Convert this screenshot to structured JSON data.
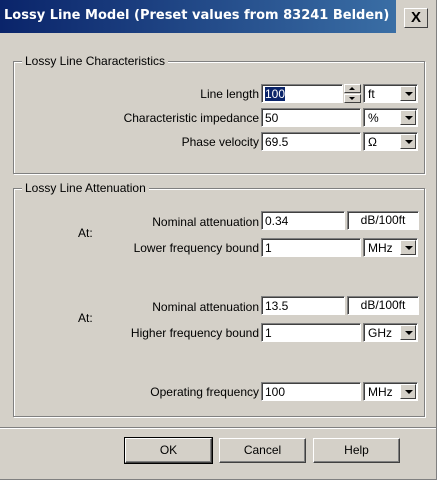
{
  "window": {
    "title": "Lossy Line Model (Preset values from 83241 Belden)",
    "close_label": "X"
  },
  "characteristics": {
    "group_label": "Lossy Line  Characteristics",
    "line_length": {
      "label": "Line length",
      "value": "100",
      "unit": "ft"
    },
    "impedance": {
      "label": "Characteristic impedance",
      "value": "50",
      "unit": "%"
    },
    "phase_velocity": {
      "label": "Phase velocity",
      "value": "69.5",
      "unit": "Ω"
    }
  },
  "attenuation": {
    "group_label": "Lossy Line Attenuation",
    "lower": {
      "nominal_label": "Nominal attenuation",
      "at_label": "At:",
      "nominal_value": "0.34",
      "nominal_unit": "dB/100ft",
      "freq_label": "Lower frequency bound",
      "freq_value": "1",
      "freq_unit": "MHz"
    },
    "higher": {
      "nominal_label": "Nominal attenuation",
      "at_label": "At:",
      "nominal_value": "13.5",
      "nominal_unit": "dB/100ft",
      "freq_label": "Higher frequency bound",
      "freq_value": "1",
      "freq_unit": "GHz"
    },
    "operating": {
      "label": "Operating frequency",
      "value": "100",
      "unit": "MHz"
    }
  },
  "buttons": {
    "ok_label": "OK",
    "cancel_label": "Cancel",
    "help_label": "Help"
  },
  "colors": {
    "title_start": "#0a246a",
    "title_end": "#3a6ea5",
    "face": "#d4d0c8",
    "selection": "#0a246a"
  }
}
